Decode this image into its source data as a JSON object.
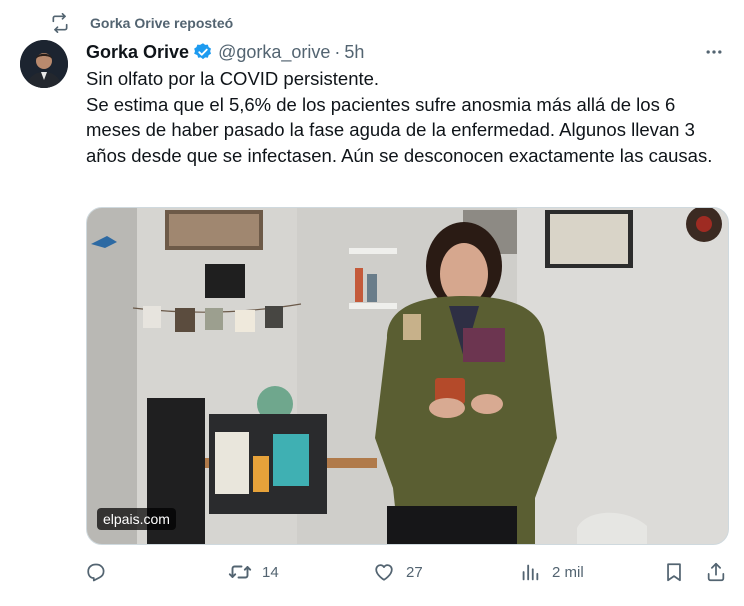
{
  "repost": {
    "text": "Gorka Orive reposteó",
    "icon": "repost-icon"
  },
  "author": {
    "name": "Gorka Orive",
    "handle": "@gorka_orive",
    "separator": "·",
    "time": "5h",
    "verified": true,
    "verified_color": "#1d9bf0"
  },
  "tweet": {
    "lines": [
      "Sin olfato por la COVID persistente.",
      "Se estima que el 5,6% de los pacientes sufre anosmia más allá de los 6 meses de haber pasado la fase aguda de la enfermedad. Algunos llevan 3 años desde que se infectasen. Aún se desconocen exactamente las causas."
    ]
  },
  "media": {
    "source": "elpais.com"
  },
  "actions": {
    "reply": {
      "icon": "reply-icon",
      "count": ""
    },
    "retweet": {
      "icon": "retweet-icon",
      "count": "14"
    },
    "like": {
      "icon": "heart-icon",
      "count": "27"
    },
    "views": {
      "icon": "analytics-icon",
      "count": "2 mil"
    },
    "bookmark": {
      "icon": "bookmark-icon"
    },
    "share": {
      "icon": "share-icon"
    }
  },
  "colors": {
    "text": "#0f1419",
    "secondary": "#536471",
    "accent": "#1d9bf0"
  }
}
